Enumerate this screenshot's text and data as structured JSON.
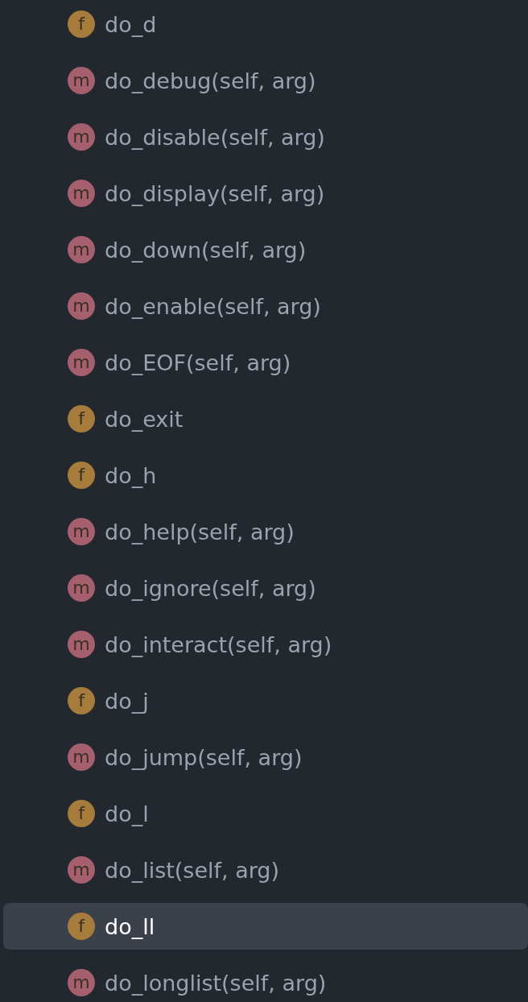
{
  "items": [
    {
      "kind": "function",
      "badge": "f",
      "label": "do_d",
      "selected": false
    },
    {
      "kind": "method",
      "badge": "m",
      "label": "do_debug(self, arg)",
      "selected": false
    },
    {
      "kind": "method",
      "badge": "m",
      "label": "do_disable(self, arg)",
      "selected": false
    },
    {
      "kind": "method",
      "badge": "m",
      "label": "do_display(self, arg)",
      "selected": false
    },
    {
      "kind": "method",
      "badge": "m",
      "label": "do_down(self, arg)",
      "selected": false
    },
    {
      "kind": "method",
      "badge": "m",
      "label": "do_enable(self, arg)",
      "selected": false
    },
    {
      "kind": "method",
      "badge": "m",
      "label": "do_EOF(self, arg)",
      "selected": false
    },
    {
      "kind": "function",
      "badge": "f",
      "label": "do_exit",
      "selected": false
    },
    {
      "kind": "function",
      "badge": "f",
      "label": "do_h",
      "selected": false
    },
    {
      "kind": "method",
      "badge": "m",
      "label": "do_help(self, arg)",
      "selected": false
    },
    {
      "kind": "method",
      "badge": "m",
      "label": "do_ignore(self, arg)",
      "selected": false
    },
    {
      "kind": "method",
      "badge": "m",
      "label": "do_interact(self, arg)",
      "selected": false
    },
    {
      "kind": "function",
      "badge": "f",
      "label": "do_j",
      "selected": false
    },
    {
      "kind": "method",
      "badge": "m",
      "label": "do_jump(self, arg)",
      "selected": false
    },
    {
      "kind": "function",
      "badge": "f",
      "label": "do_l",
      "selected": false
    },
    {
      "kind": "method",
      "badge": "m",
      "label": "do_list(self, arg)",
      "selected": false
    },
    {
      "kind": "function",
      "badge": "f",
      "label": "do_ll",
      "selected": true
    },
    {
      "kind": "method",
      "badge": "m",
      "label": "do_longlist(self, arg)",
      "selected": false
    }
  ]
}
